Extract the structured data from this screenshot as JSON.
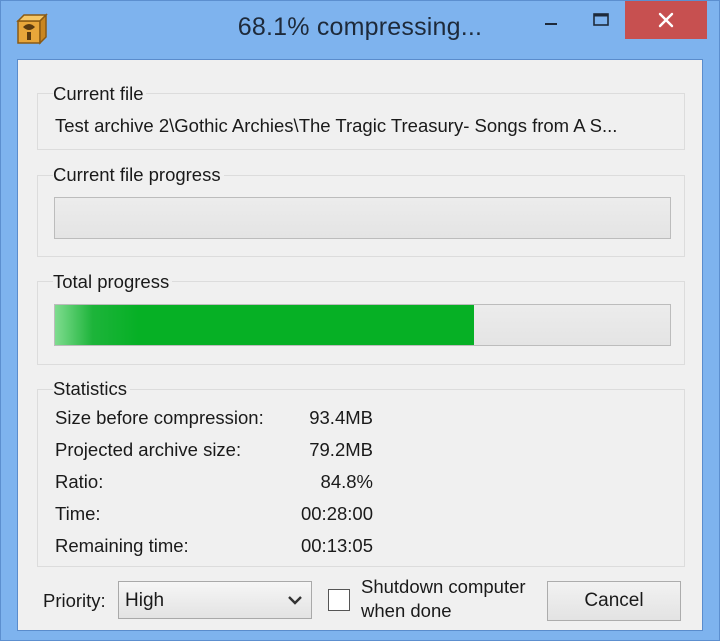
{
  "window": {
    "title": "68.1% compressing..."
  },
  "current_file": {
    "label": "Current file",
    "path": "Test archive 2\\Gothic Archies\\The Tragic Treasury- Songs from A S..."
  },
  "current_file_progress": {
    "label": "Current file progress",
    "value": 0
  },
  "total_progress": {
    "label": "Total progress",
    "value": 0.681
  },
  "statistics": {
    "label": "Statistics",
    "rows": [
      {
        "label": "Size before compression:",
        "value": "93.4MB"
      },
      {
        "label": "Projected archive size:",
        "value": "79.2MB"
      },
      {
        "label": "Ratio:",
        "value": "84.8%"
      },
      {
        "label": "Time:",
        "value": "00:28:00"
      },
      {
        "label": "Remaining time:",
        "value": "00:13:05"
      }
    ]
  },
  "priority": {
    "label": "Priority:",
    "selected": "High"
  },
  "shutdown": {
    "label_line1": "Shutdown computer",
    "label_line2": "when done",
    "checked": false
  },
  "cancel_label": "Cancel",
  "colors": {
    "titlebar": "#7eb3ee",
    "close_button": "#c75050",
    "progress_fill": "#06b025",
    "dialog_bg": "#f0f0f0"
  },
  "icons": {
    "app": "archiver-app-icon",
    "minimize": "minimize-icon",
    "maximize": "maximize-icon",
    "close": "close-icon",
    "dropdown": "chevron-down-icon"
  }
}
